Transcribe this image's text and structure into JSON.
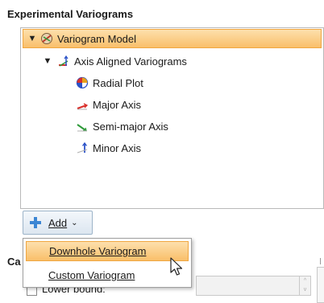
{
  "section_title": "Experimental Variograms",
  "tree": {
    "model": {
      "label": "Variogram Model",
      "toggle": "▼"
    },
    "axis_group": {
      "label": "Axis Aligned Variograms",
      "toggle": "▼"
    },
    "children": [
      {
        "label": "Radial Plot",
        "icon": "radial-plot-icon"
      },
      {
        "label": "Major Axis",
        "icon": "major-axis-icon"
      },
      {
        "label": "Semi-major Axis",
        "icon": "semi-major-axis-icon"
      },
      {
        "label": "Minor Axis",
        "icon": "minor-axis-icon"
      }
    ]
  },
  "add_button": {
    "label": "Add",
    "icon": "plus-icon"
  },
  "menu": {
    "items": [
      {
        "label": "Downhole Variogram",
        "highlighted": true
      },
      {
        "label": "Custom Variogram",
        "highlighted": false
      }
    ]
  },
  "behind": {
    "section_label_partial": "Ca",
    "lower_bound_label": "Lower bound:"
  },
  "colors": {
    "selection": "#f9bf6a",
    "red_axis": "#d9302c",
    "green_axis": "#2f9a3a",
    "blue_axis": "#2b52c8"
  }
}
